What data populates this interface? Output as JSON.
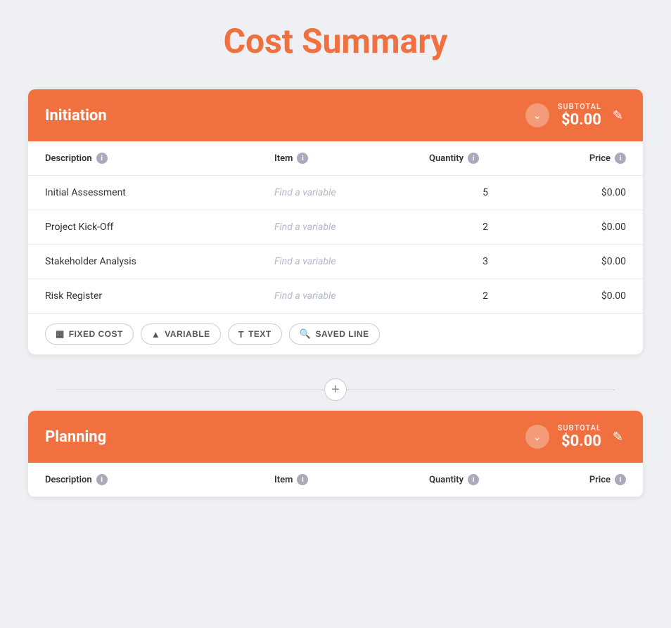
{
  "page": {
    "title": "Cost Summary"
  },
  "sections": [
    {
      "id": "initiation",
      "title": "Initiation",
      "subtotal_label": "SUBTOTAL",
      "subtotal_value": "$0.00",
      "rows": [
        {
          "description": "Initial Assessment",
          "item_placeholder": "Find a variable",
          "quantity": "5",
          "price": "$0.00"
        },
        {
          "description": "Project Kick-Off",
          "item_placeholder": "Find a variable",
          "quantity": "2",
          "price": "$0.00"
        },
        {
          "description": "Stakeholder Analysis",
          "item_placeholder": "Find a variable",
          "quantity": "3",
          "price": "$0.00"
        },
        {
          "description": "Risk Register",
          "item_placeholder": "Find a variable",
          "quantity": "2",
          "price": "$0.00"
        }
      ],
      "actions": [
        {
          "id": "fixed-cost",
          "icon": "▦",
          "label": "FIXED COST"
        },
        {
          "id": "variable",
          "icon": "▲",
          "label": "VARIABLE"
        },
        {
          "id": "text",
          "icon": "T",
          "label": "TEXT"
        },
        {
          "id": "saved-line",
          "icon": "🔍",
          "label": "SAVED LINE"
        }
      ]
    },
    {
      "id": "planning",
      "title": "Planning",
      "subtotal_label": "SUBTOTAL",
      "subtotal_value": "$0.00",
      "rows": [],
      "actions": []
    }
  ],
  "table_headers": {
    "description": "Description",
    "item": "Item",
    "quantity": "Quantity",
    "price": "Price"
  },
  "add_section_label": "+"
}
